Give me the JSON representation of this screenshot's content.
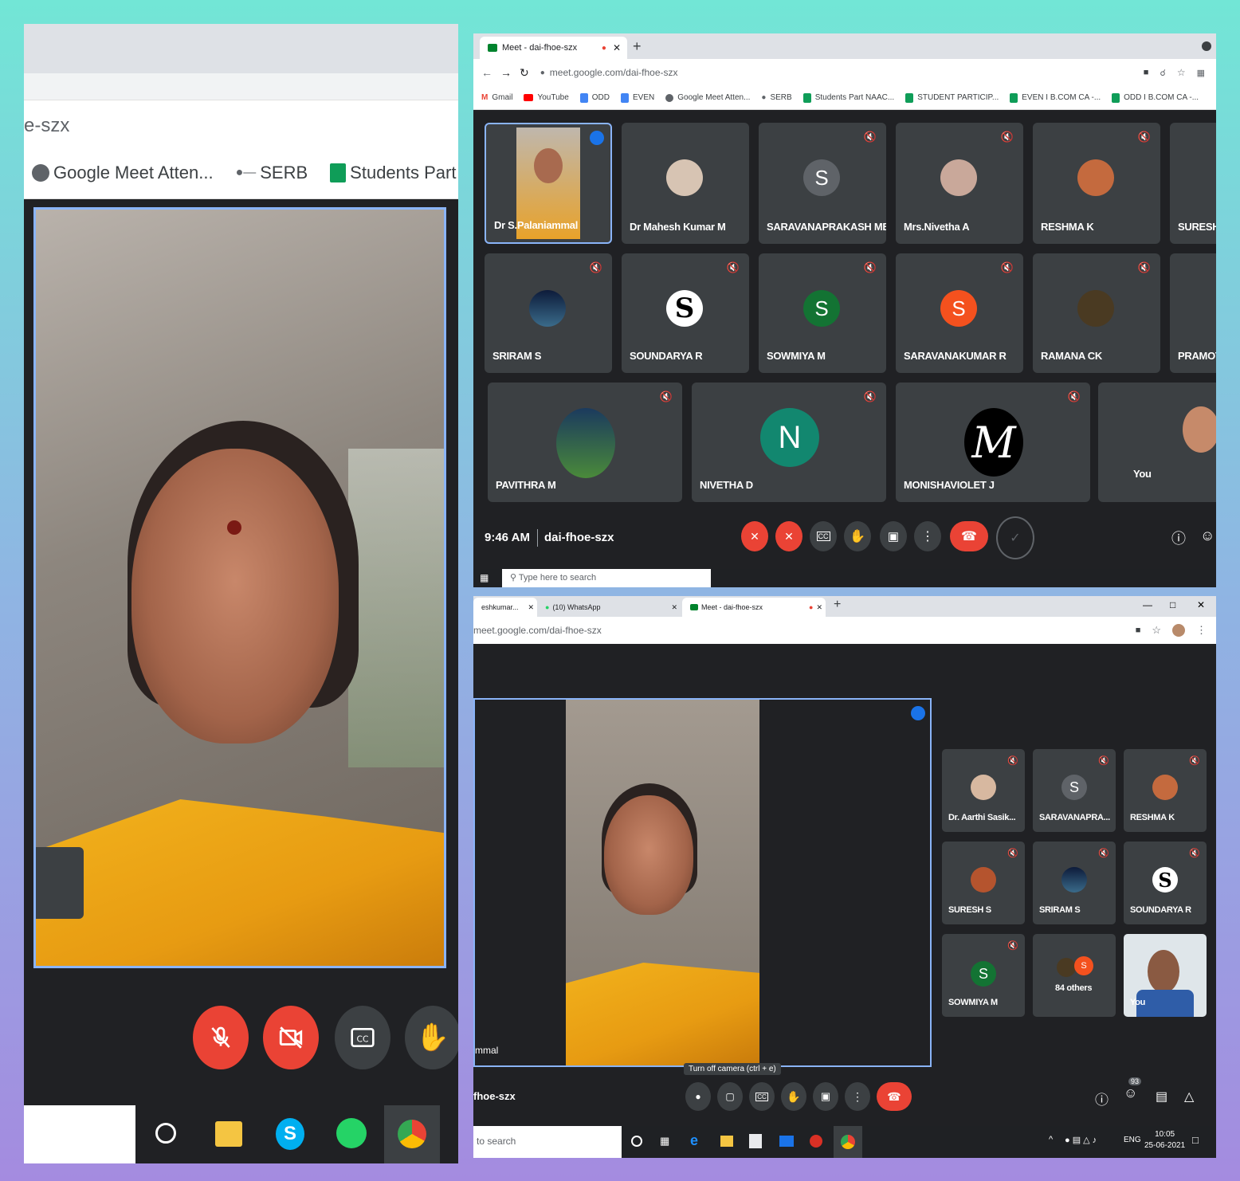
{
  "left": {
    "address_fragment": "e-szx",
    "bookmarks": [
      {
        "icon": "globe-icon",
        "label": "Google Meet Atten..."
      },
      {
        "icon": "serb-icon",
        "label": "SERB"
      },
      {
        "icon": "sheets-icon",
        "label": "Students Part NAAC"
      }
    ]
  },
  "top_right": {
    "tab_title": "Meet - dai-fhoe-szx",
    "url": "meet.google.com/dai-fhoe-szx",
    "bookmarks": [
      "Gmail",
      "YouTube",
      "ODD",
      "EVEN",
      "Google Meet Atten...",
      "SERB",
      "Students Part NAAC...",
      "STUDENT PARTICIP...",
      "EVEN I B.COM CA -...",
      "ODD I B.COM CA -..."
    ],
    "participants": [
      {
        "name": "Dr S.Palaniammal",
        "avatar": "photo"
      },
      {
        "name": "Dr Mahesh Kumar M",
        "avatar": "photo"
      },
      {
        "name": "SARAVANAPRAKASH ME",
        "avatar": "S"
      },
      {
        "name": "Mrs.Nivetha A",
        "avatar": "photo"
      },
      {
        "name": "RESHMA K",
        "avatar": "photo"
      },
      {
        "name": "SURESH S",
        "avatar": "photo"
      },
      {
        "name": "SRIRAM S",
        "avatar": "photo"
      },
      {
        "name": "SOUNDARYA R",
        "avatar": "S"
      },
      {
        "name": "SOWMIYA M",
        "avatar": "S"
      },
      {
        "name": "SARAVANAKUMAR R",
        "avatar": "S"
      },
      {
        "name": "RAMANA CK",
        "avatar": "photo"
      },
      {
        "name": "PRAMOT",
        "avatar": "photo"
      },
      {
        "name": "PAVITHRA M",
        "avatar": "photo"
      },
      {
        "name": "NIVETHA D",
        "avatar": "N"
      },
      {
        "name": "MONISHAVIOLET J",
        "avatar": "M"
      },
      {
        "name": "You",
        "avatar": "photo"
      }
    ],
    "time": "9:46 AM",
    "meeting_code": "dai-fhoe-szx",
    "taskbar_search": "Type here to search"
  },
  "bottom_right": {
    "tabs": [
      "eshkumar...",
      "(10) WhatsApp",
      "Meet - dai-fhoe-szx"
    ],
    "url": "meet.google.com/dai-fhoe-szx",
    "main_name_fragment": "mmal",
    "participants": [
      {
        "name": "Dr. Aarthi Sasik...",
        "avatar": "photo"
      },
      {
        "name": "SARAVANAPRA...",
        "avatar": "S"
      },
      {
        "name": "RESHMA K",
        "avatar": "photo"
      },
      {
        "name": "SURESH S",
        "avatar": "photo"
      },
      {
        "name": "SRIRAM S",
        "avatar": "photo"
      },
      {
        "name": "SOUNDARYA R",
        "avatar": "S"
      },
      {
        "name": "SOWMIYA M",
        "avatar": "S"
      },
      {
        "name": "84 others",
        "avatar": "group"
      },
      {
        "name": "You",
        "avatar": "photo"
      }
    ],
    "tooltip": "Turn off camera (ctrl + e)",
    "meeting_code_fragment": "fhoe-szx",
    "people_count": "93",
    "taskbar_search_fragment": "to search",
    "tray_lang": "ENG",
    "clock_time": "10:05",
    "clock_date": "25-06-2021"
  },
  "colors": {
    "meet_bg": "#202124",
    "tile_bg": "#3c4043",
    "red": "#ea4335",
    "accent_blue": "#8ab4f8"
  }
}
